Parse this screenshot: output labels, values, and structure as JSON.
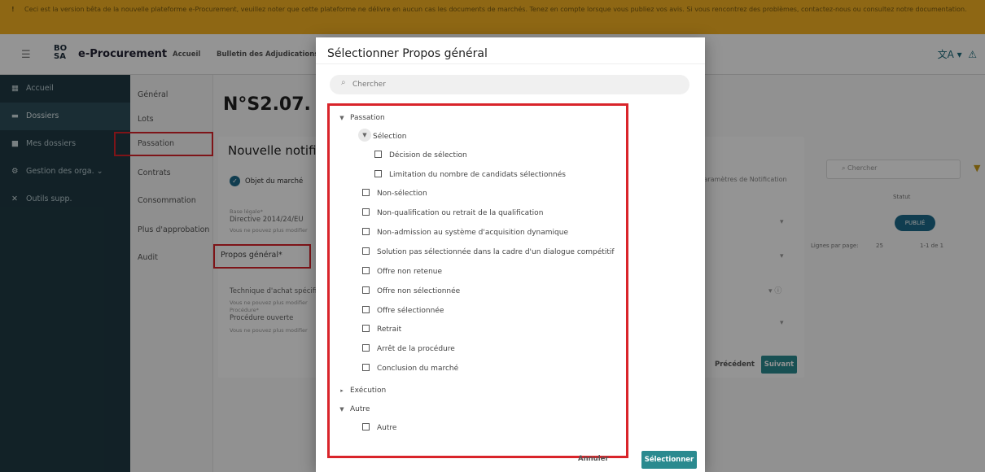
{
  "banner": {
    "text": "Ceci est la version bêta de la nouvelle plateforme e-Procurement, veuillez noter que cette plateforme ne délivre en aucun cas les documents de marchés. Tenez en compte lorsque vous publiez vos avis. Si vous rencontrez des problèmes, contactez-nous ou consultez notre documentation."
  },
  "header": {
    "logo": "BO\nSA",
    "app_name": "e-Procurement",
    "nav": [
      "Accueil",
      "Bulletin des Adjudications"
    ]
  },
  "sidebar": {
    "items": [
      {
        "icon": "dashboard-icon",
        "label": "Accueil"
      },
      {
        "icon": "folder-icon",
        "label": "Dossiers"
      },
      {
        "icon": "bookmark-icon",
        "label": "Mes dossiers"
      },
      {
        "icon": "org-icon",
        "label": "Gestion des orga.",
        "chevron": "⌄"
      },
      {
        "icon": "tools-icon",
        "label": "Outils supp."
      }
    ]
  },
  "subnav": {
    "items": [
      "Général",
      "Lots",
      "Passation",
      "Contrats",
      "Consommation",
      "Plus d'approbation",
      "Audit"
    ]
  },
  "main": {
    "title": "N°S2.07."
  },
  "notification": {
    "title": "Nouvelle notific",
    "step1": "Objet du marché",
    "step2": "Paramètres de Notification",
    "field1_label": "Base légale*",
    "field1_value": "Directive 2014/24/EU",
    "field1_hint": "Vous ne pouvez plus modifier",
    "propos_label": "Propos général*",
    "field3_value": "Technique d'achat spécifique",
    "field3_hint": "Vous ne pouvez plus modifier",
    "field4_label": "Procédure*",
    "field4_value": "Procédure ouverte",
    "field4_hint": "Vous ne pouvez plus modifier",
    "prev": "Précédent",
    "next": "Suivant"
  },
  "right_table": {
    "search_placeholder": "Chercher",
    "status_header": "Statut",
    "status_value": "PUBLIÉ",
    "rows_per_page": "Lignes par page:",
    "rows_value": "25",
    "pagination": "1-1 de 1"
  },
  "dialog": {
    "title": "Sélectionner Propos général",
    "search_placeholder": "Chercher",
    "tree": {
      "passation": "Passation",
      "selection": "Sélection",
      "decision_selection": "Décision de sélection",
      "limitation": "Limitation du nombre de candidats sélectionnés",
      "non_selection": "Non-sélection",
      "non_qualification": "Non-qualification ou retrait de la qualification",
      "non_admission": "Non-admission au système d'acquisition dynamique",
      "solution": "Solution pas sélectionnée dans la cadre d'un dialogue compétitif",
      "offre_non_retenue": "Offre non retenue",
      "offre_non_selectionnee": "Offre non sélectionnée",
      "offre_selectionnee": "Offre sélectionnée",
      "retrait": "Retrait",
      "arret": "Arrêt de la procédure",
      "conclusion": "Conclusion du marché",
      "execution": "Exécution",
      "autre_group": "Autre",
      "autre_item": "Autre"
    },
    "cancel": "Annuler",
    "select": "Sélectionner"
  }
}
